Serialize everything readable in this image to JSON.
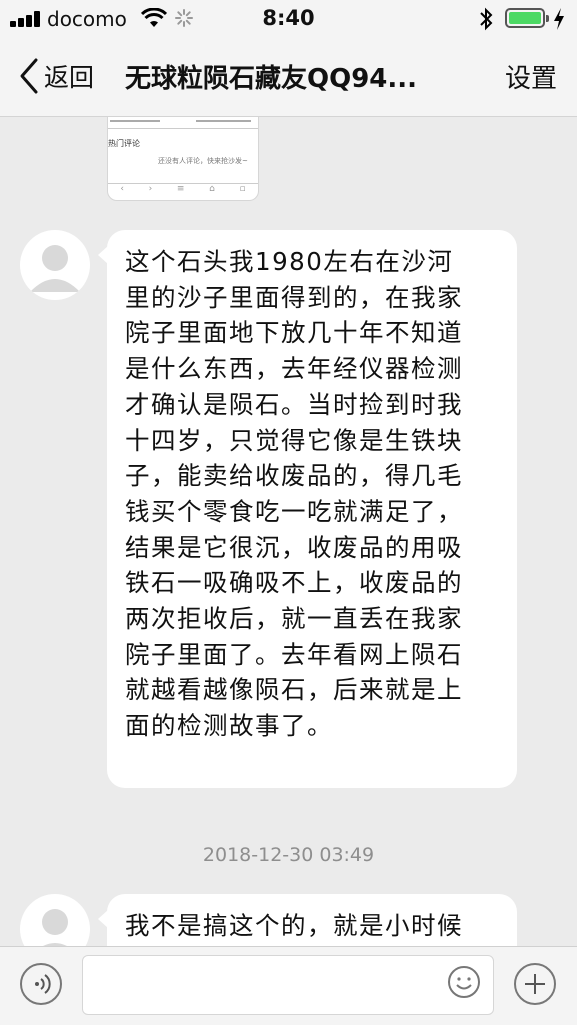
{
  "status_bar": {
    "carrier": "docomo",
    "time": "8:40",
    "battery_color": "#4cd964"
  },
  "nav": {
    "back_label": "返回",
    "title": "无球粒陨石藏友QQ94...",
    "settings_label": "设置"
  },
  "shared_link_preview": {
    "section_heading": "热门评论",
    "empty_text": "还没有人评论，快来抢沙发~"
  },
  "messages": [
    {
      "lines": [
        "这个石头我1980左右在沙河",
        "里的沙子里面得到的，在我家",
        "院子里面地下放几十年不知道",
        "是什么东西，去年经仪器检测",
        "才确认是陨石。当时捡到时我",
        "十四岁，只觉得它像是生铁块",
        "子，能卖给收废品的，得几毛",
        "钱买个零食吃一吃就满足了，",
        "结果是它很沉，收废品的用吸",
        "铁石一吸确吸不上，收废品的",
        "两次拒收后，就一直丢在我家",
        "院子里面了。去年看网上陨石",
        "就越看越像陨石，后来就是上",
        "面的检测故事了。"
      ]
    },
    {
      "lines": [
        "我不是搞这个的，就是小时候"
      ]
    }
  ],
  "timestamp": "2018-12-30 03:49",
  "colors": {
    "background": "#ebebeb",
    "bubble": "#ffffff",
    "bars": "#f4f4f4"
  }
}
